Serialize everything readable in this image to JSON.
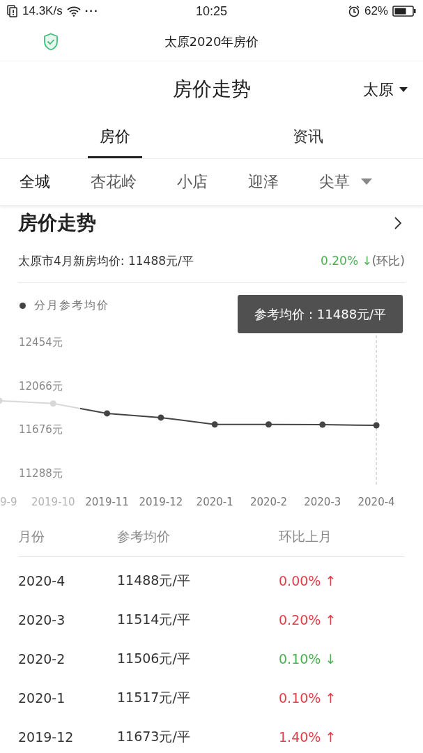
{
  "status_bar": {
    "speed": "14.3K/s",
    "more": "···",
    "time": "10:25",
    "battery": "62%"
  },
  "browser_bar": {
    "title": "太原2020年房价"
  },
  "header": {
    "title": "房价走势",
    "city": "太原"
  },
  "tabs": [
    {
      "label": "房价",
      "selected": true
    },
    {
      "label": "资讯",
      "selected": false
    }
  ],
  "districts": [
    {
      "label": "全城",
      "selected": true
    },
    {
      "label": "杏花岭",
      "selected": false
    },
    {
      "label": "小店",
      "selected": false
    },
    {
      "label": "迎泽",
      "selected": false
    },
    {
      "label": "尖草",
      "selected": false
    }
  ],
  "section": {
    "title": "房价走势",
    "summary": "太原市4月新房均价: 11488元/平",
    "change": "0.20% ↓",
    "change_note": "(环比)"
  },
  "chart": {
    "tooltip": "参考均价：11488元/平",
    "chart_data": {
      "type": "line",
      "categories": [
        "9-9",
        "2019-10",
        "2019-11",
        "2019-12",
        "2020-1",
        "2020-2",
        "2020-3",
        "2020-4"
      ],
      "series": [
        {
          "name": "分月参考均价",
          "color": "#444444",
          "marker": true,
          "values": [
            11941,
            11916,
            11828,
            11791,
            11730,
            11730,
            11728,
            11722
          ]
        }
      ],
      "ylim": [
        11288,
        12454
      ],
      "yticks": [
        {
          "value": 12454,
          "label": "12454元"
        },
        {
          "value": 12066,
          "label": "12066元"
        },
        {
          "value": 11676,
          "label": "11676元"
        },
        {
          "value": 11288,
          "label": "11288元"
        }
      ]
    }
  },
  "table": {
    "columns": [
      "月份",
      "参考均价",
      "环比上月"
    ],
    "rows": [
      {
        "month": "2020-4",
        "price": "11488元/平",
        "change": "0.00% ↑",
        "color": "#e0404a"
      },
      {
        "month": "2020-3",
        "price": "11514元/平",
        "change": "0.20% ↑",
        "color": "#e0404a"
      },
      {
        "month": "2020-2",
        "price": "11506元/平",
        "change": "0.10% ↓",
        "color": "#4cb050"
      },
      {
        "month": "2020-1",
        "price": "11517元/平",
        "change": "0.10% ↑",
        "color": "#e0404a"
      },
      {
        "month": "2019-12",
        "price": "11673元/平",
        "change": "1.40% ↑",
        "color": "#e0404a"
      }
    ]
  }
}
